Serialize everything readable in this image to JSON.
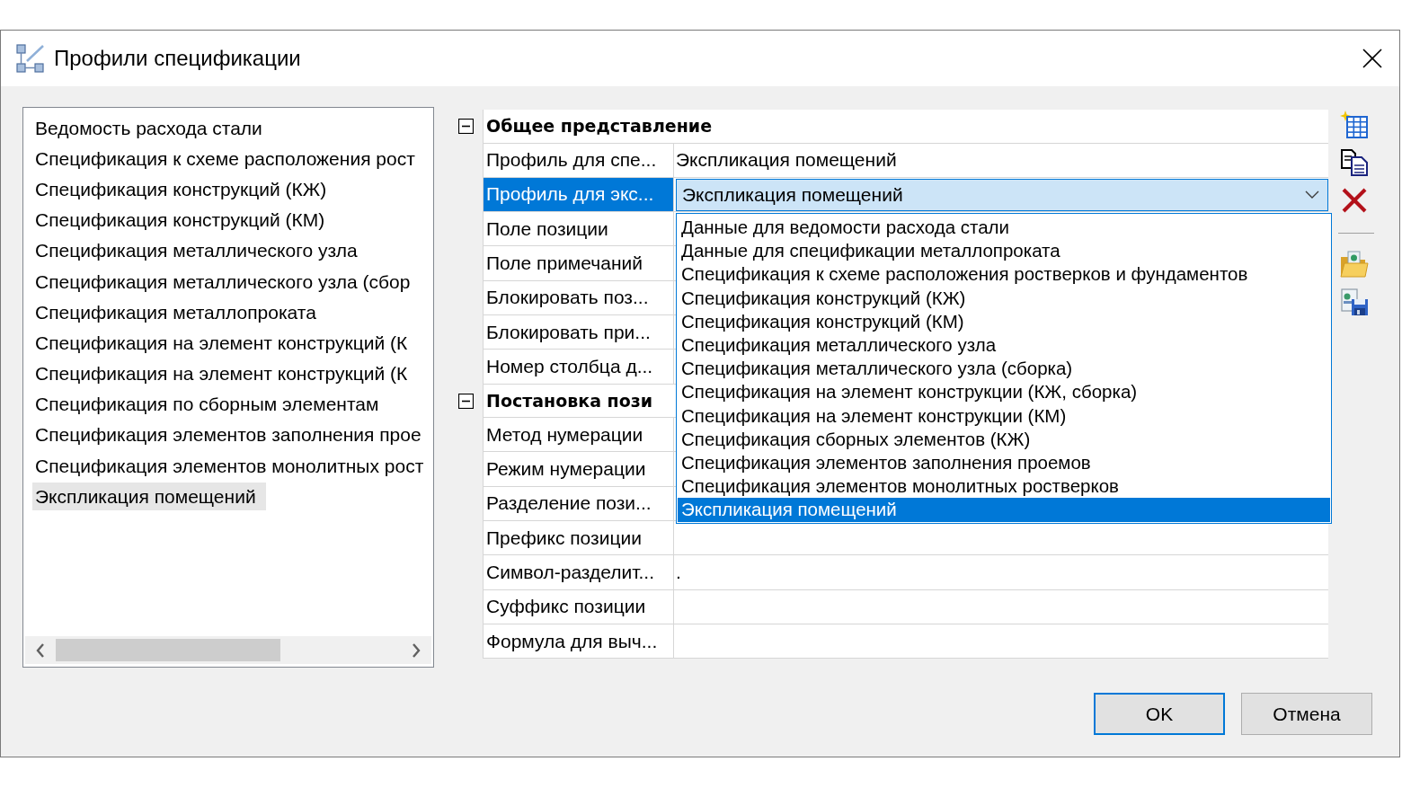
{
  "window": {
    "title": "Профили спецификации"
  },
  "profiles": [
    {
      "label": "Ведомость расхода стали",
      "selected": false
    },
    {
      "label": "Спецификация к схеме расположения рост",
      "selected": false
    },
    {
      "label": "Спецификация конструкций (КЖ)",
      "selected": false
    },
    {
      "label": "Спецификация конструкций (КМ)",
      "selected": false
    },
    {
      "label": "Спецификация металлического узла",
      "selected": false
    },
    {
      "label": "Спецификация металлического узла (сбор",
      "selected": false
    },
    {
      "label": "Спецификация металлопроката",
      "selected": false
    },
    {
      "label": "Спецификация на элемент конструкций (К",
      "selected": false
    },
    {
      "label": "Спецификация на элемент конструкций (К",
      "selected": false
    },
    {
      "label": "Спецификация по сборным элементам",
      "selected": false
    },
    {
      "label": "Спецификация элементов заполнения прое",
      "selected": false
    },
    {
      "label": "Спецификация элементов монолитных рост",
      "selected": false
    },
    {
      "label": "Экспликация помещений",
      "selected": true
    }
  ],
  "properties": {
    "groups": [
      {
        "title": "Общее представление",
        "expanded": true,
        "rows": [
          {
            "label": "Профиль для спе...",
            "selected": false,
            "kind": "text",
            "value": "Экспликация помещений"
          },
          {
            "label": "Профиль для экс...",
            "selected": true,
            "kind": "combo",
            "value": "Экспликация помещений",
            "open": true,
            "options": [
              {
                "label": "Данные для ведомости расхода стали",
                "selected": false
              },
              {
                "label": "Данные для спецификации металлопроката",
                "selected": false
              },
              {
                "label": "Спецификация к схеме расположения ростверков и фундаментов",
                "selected": false
              },
              {
                "label": "Спецификация конструкций (КЖ)",
                "selected": false
              },
              {
                "label": "Спецификация конструкций (КМ)",
                "selected": false
              },
              {
                "label": "Спецификация металлического узла",
                "selected": false
              },
              {
                "label": "Спецификация металлического узла (сборка)",
                "selected": false
              },
              {
                "label": "Спецификация на элемент конструкции (КЖ, сборка)",
                "selected": false
              },
              {
                "label": "Спецификация на элемент конструкции (КМ)",
                "selected": false
              },
              {
                "label": "Спецификация сборных элементов (КЖ)",
                "selected": false
              },
              {
                "label": "Спецификация элементов заполнения проемов",
                "selected": false
              },
              {
                "label": "Спецификация элементов монолитных ростверков",
                "selected": false
              },
              {
                "label": "Экспликация помещений",
                "selected": true
              }
            ]
          },
          {
            "label": "Поле позиции",
            "selected": false,
            "kind": "text"
          },
          {
            "label": "Поле примечаний",
            "selected": false,
            "kind": "text"
          },
          {
            "label": "Блокировать поз...",
            "selected": false,
            "kind": "text"
          },
          {
            "label": "Блокировать при...",
            "selected": false,
            "kind": "text"
          },
          {
            "label": "Номер столбца д...",
            "selected": false,
            "kind": "text"
          }
        ]
      },
      {
        "title": "Постановка пози",
        "expanded": true,
        "rows": [
          {
            "label": "Метод нумерации",
            "selected": false,
            "kind": "text"
          },
          {
            "label": "Режим нумерации",
            "selected": false,
            "kind": "text"
          },
          {
            "label": "Разделение пози...",
            "selected": false,
            "kind": "text"
          },
          {
            "label": "Префикс позиции",
            "selected": false,
            "kind": "text"
          },
          {
            "label": "Символ-разделит...",
            "selected": false,
            "kind": "text",
            "value": "."
          },
          {
            "label": "Суффикс позиции",
            "selected": false,
            "kind": "text"
          },
          {
            "label": "Формула для выч...",
            "selected": false,
            "kind": "text"
          }
        ]
      }
    ]
  },
  "buttons": [
    {
      "label": "OK",
      "focused": true
    },
    {
      "label": "Отмена",
      "focused": false
    }
  ]
}
